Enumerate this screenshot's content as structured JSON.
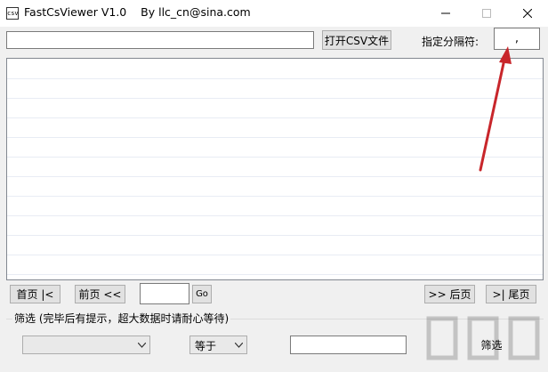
{
  "window": {
    "title": "FastCsViewer V1.0    By llc_cn@sina.com",
    "icon_text": "csv",
    "minimize_icon": "minimize-icon",
    "maximize_icon": "maximize-icon",
    "close_icon": "close-icon"
  },
  "toolbar": {
    "file_path_value": "",
    "open_csv_label": "打开CSV文件",
    "delimiter_label": "指定分隔符:",
    "delimiter_value": ","
  },
  "nav": {
    "first_label": "首页 |<",
    "prev_label": "前页 <<",
    "page_value": "",
    "go_label": "Go",
    "next_label": ">> 后页",
    "last_label": ">| 尾页"
  },
  "filter": {
    "group_label": "筛选 (完毕后有提示，超大数据时请耐心等待)",
    "column_value": "",
    "operator_value": "等于",
    "filter_value": "",
    "filter_button_label": "筛选"
  },
  "annotation": {
    "arrow_color": "#c8262b"
  }
}
